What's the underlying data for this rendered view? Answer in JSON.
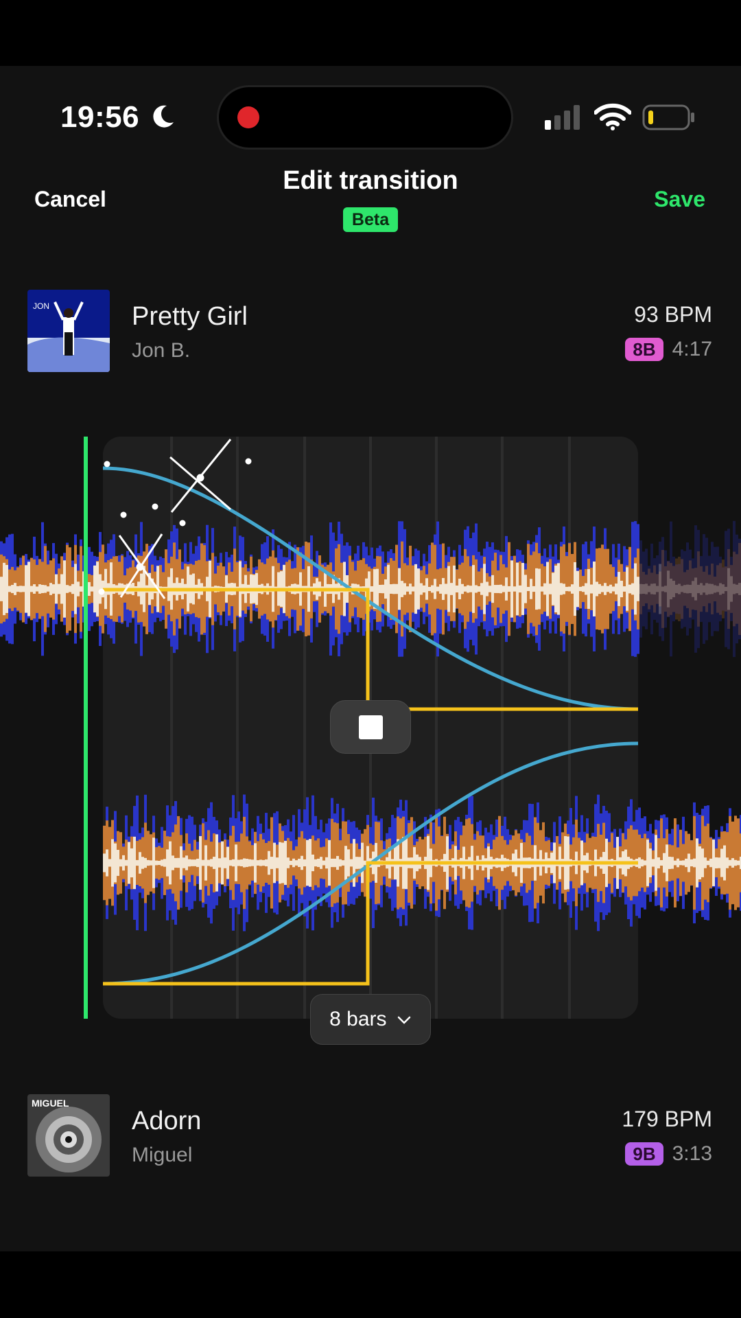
{
  "status_bar": {
    "time": "19:56"
  },
  "header": {
    "cancel_label": "Cancel",
    "title": "Edit transition",
    "badge": "Beta",
    "save_label": "Save"
  },
  "track_a": {
    "title": "Pretty Girl",
    "artist": "Jon B.",
    "bpm": "93 BPM",
    "key": "8B",
    "key_color": "#e05bd0",
    "duration": "4:17",
    "art_text": "JON"
  },
  "track_b": {
    "title": "Adorn",
    "artist": "Miguel",
    "bpm": "179 BPM",
    "key": "9B",
    "key_color": "#b45fe8",
    "duration": "3:13",
    "art_text": "MIGUEL"
  },
  "editor": {
    "bars_label": "8 bars"
  },
  "colors": {
    "accent": "#2ee66b",
    "curve_volume": "#45a8cf",
    "curve_eq": "#f5c21b",
    "wave_low": "#2a35c9",
    "wave_mid": "#c97a34",
    "wave_high": "#f3e6d3"
  }
}
